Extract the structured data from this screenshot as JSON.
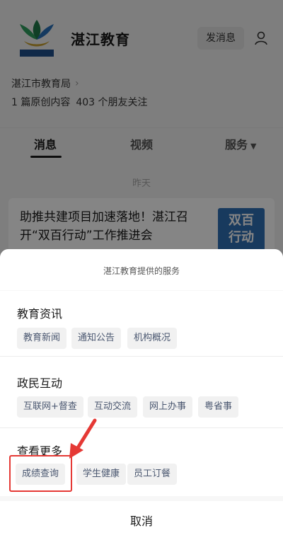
{
  "account": {
    "name": "湛江教育",
    "send_message_label": "发消息",
    "organization": "湛江市教育局",
    "original_count": "1 篇原创内容",
    "followers": "403 个朋友关注"
  },
  "tabs": [
    {
      "label": "消息",
      "active": true
    },
    {
      "label": "视频",
      "active": false
    },
    {
      "label": "服务",
      "active": false
    }
  ],
  "feed": {
    "date_label": "昨天",
    "article_title": "助推共建项目加速落地！湛江召开“双百行动”工作推进会",
    "thumb_text_line1": "双百",
    "thumb_text_line2": "行动"
  },
  "sheet": {
    "header": "湛江教育提供的服务",
    "sections": [
      {
        "title": "教育资讯",
        "items": [
          "教育新闻",
          "通知公告",
          "机构概况"
        ]
      },
      {
        "title": "政民互动",
        "items": [
          "互联网+督查",
          "互动交流",
          "网上办事",
          "粤省事"
        ]
      },
      {
        "title": "查看更多",
        "items": [
          "成绩查询",
          "学生健康",
          "员工订餐"
        ]
      }
    ],
    "cancel_label": "取消"
  },
  "colors": {
    "highlight": "#e53935",
    "chip_text": "#4a5770",
    "thumb_bg": "#2f6fb5"
  }
}
